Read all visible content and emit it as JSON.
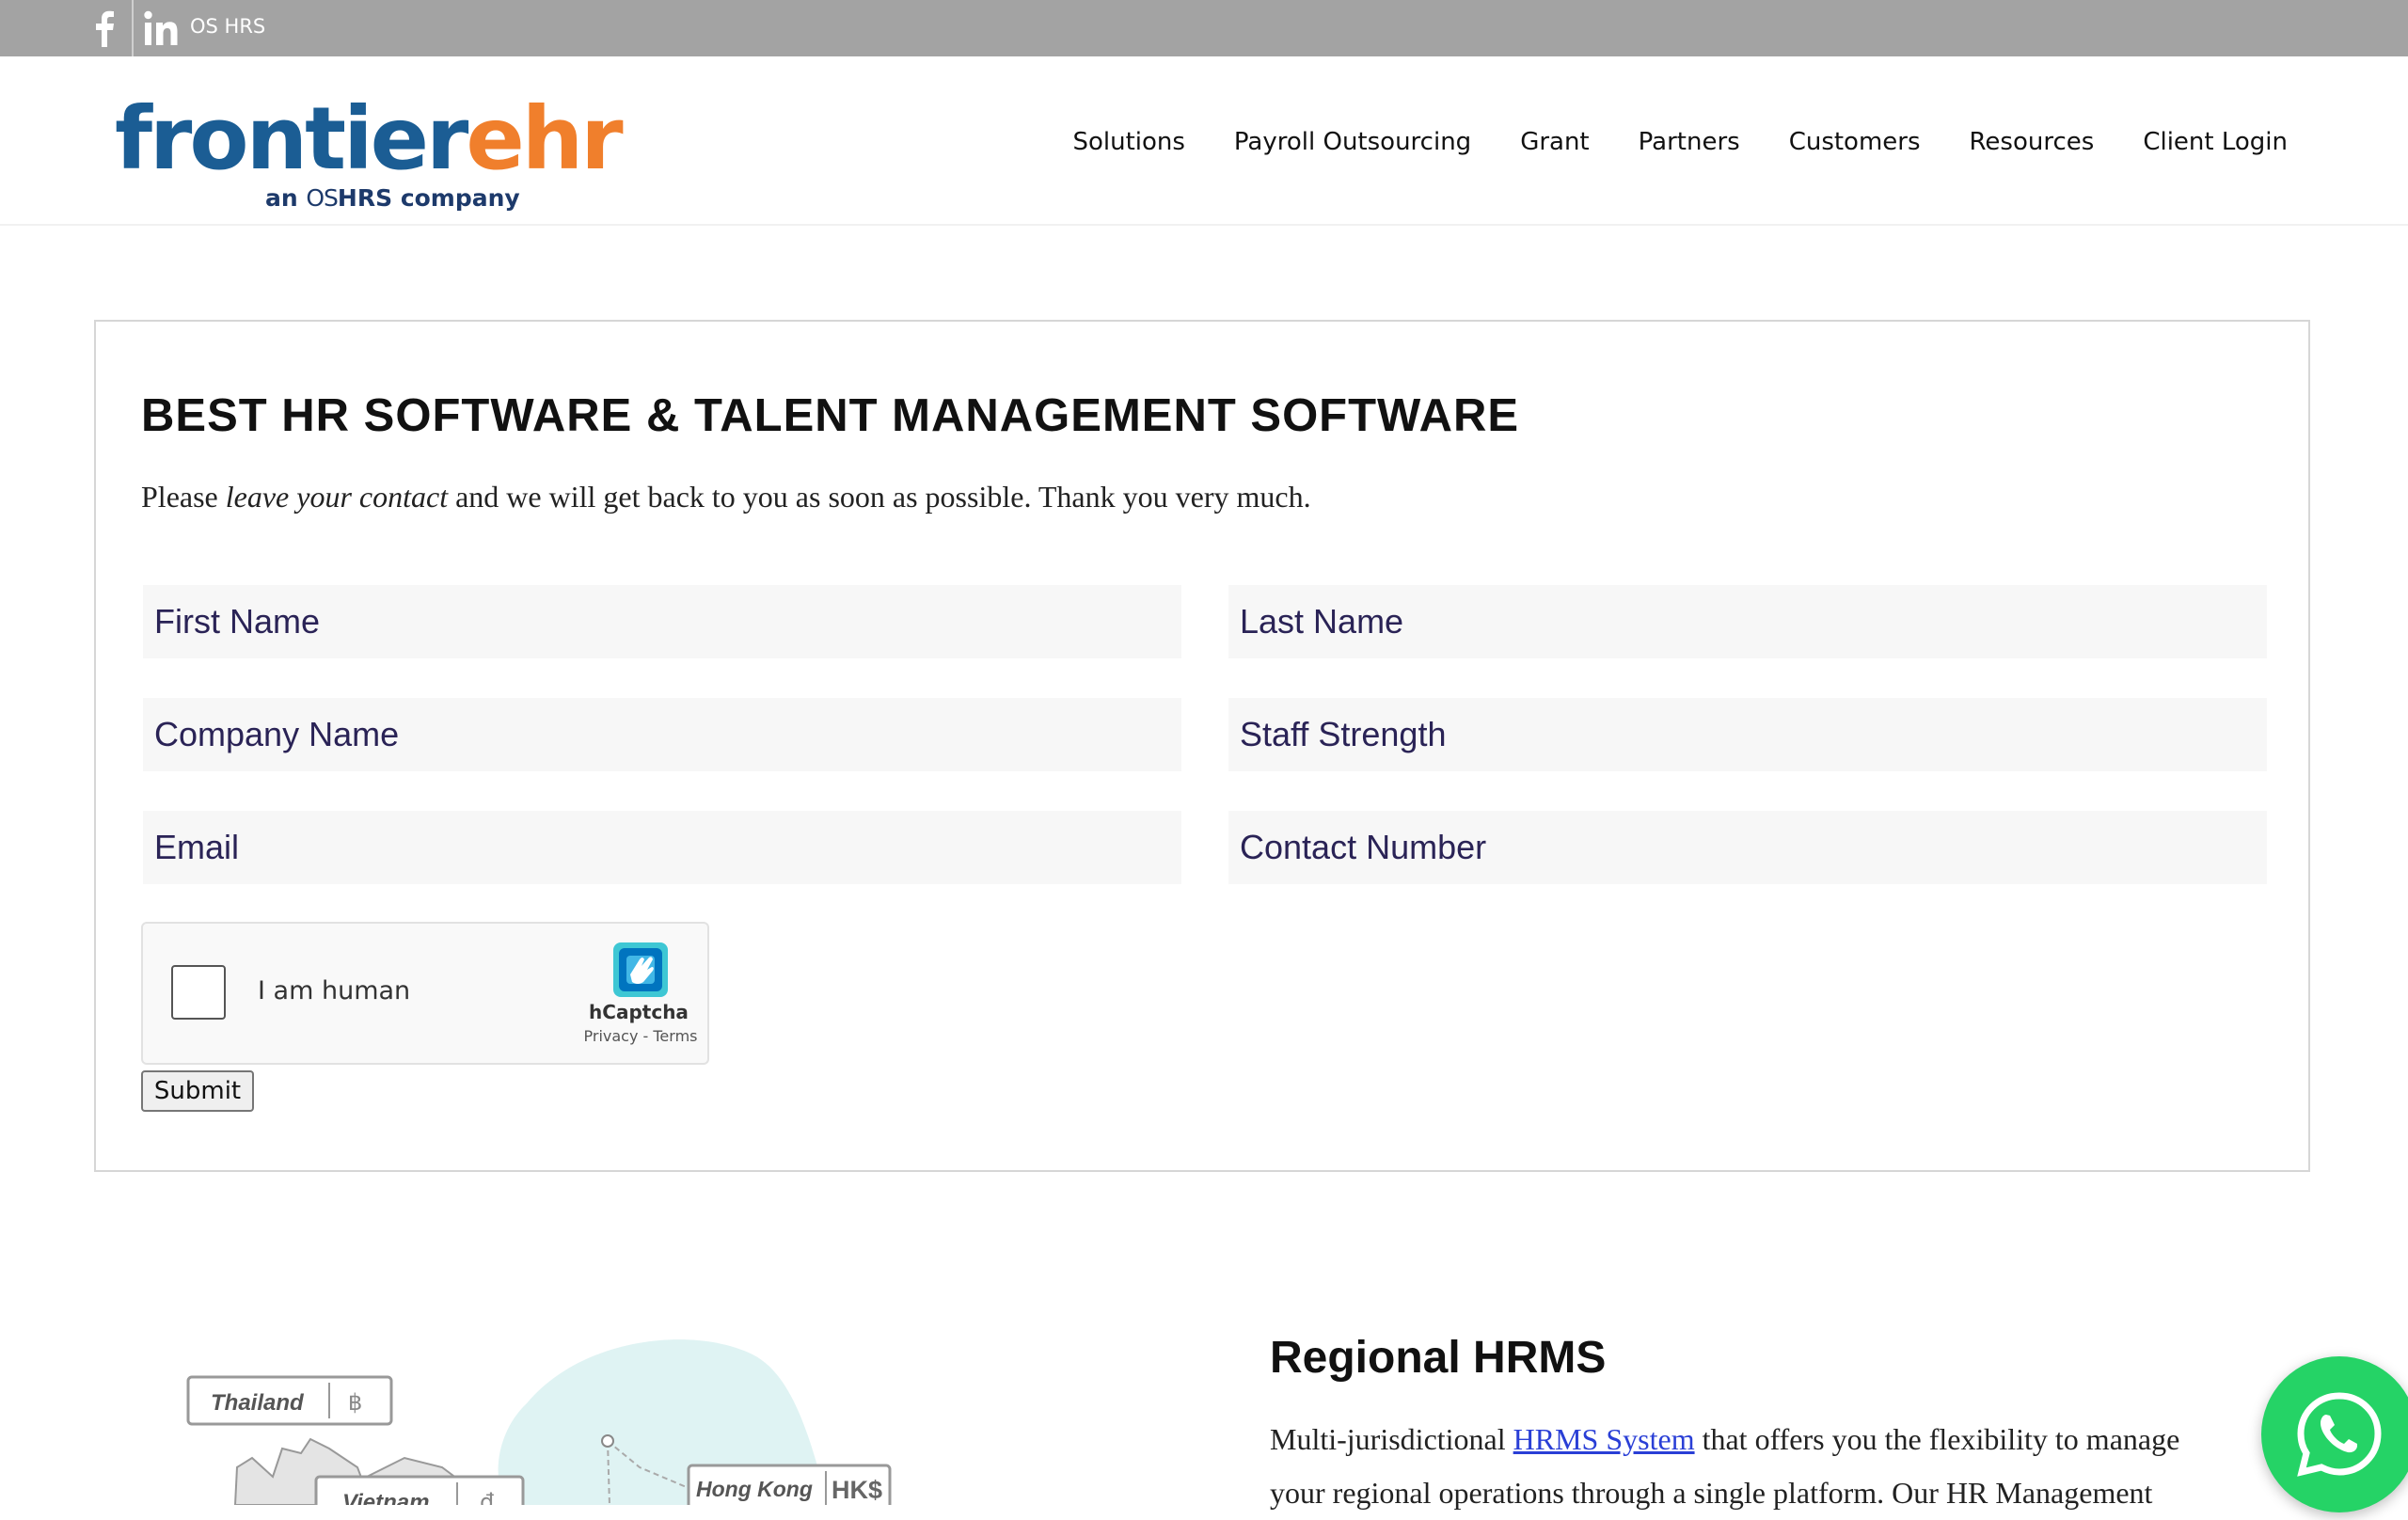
{
  "topbar": {
    "brand": "OS HRS",
    "icons": [
      "facebook-icon",
      "linkedin-icon"
    ],
    "background": "#a3a3a3"
  },
  "logo": {
    "word_part1": "frontier",
    "word_part2": "ehr",
    "sub_prefix": "an ",
    "sub_os": "OS",
    "sub_hrs": "HRS",
    "sub_suffix": " company",
    "colors": {
      "primary": "#1b5d94",
      "accent": "#f07f2c"
    }
  },
  "nav": {
    "items": [
      "Solutions",
      "Payroll Outsourcing",
      "Grant",
      "Partners",
      "Customers",
      "Resources",
      "Client Login"
    ]
  },
  "form": {
    "title": "BEST HR SOFTWARE & TALENT MANAGEMENT SOFTWARE",
    "subtitle_before": "Please ",
    "subtitle_em": "leave your contact",
    "subtitle_after": " and we will get back to you as soon as possible. Thank you very much.",
    "fields": {
      "first_name": "First Name",
      "last_name": "Last Name",
      "company_name": "Company Name",
      "staff_strength": "Staff Strength",
      "email": "Email",
      "contact_number": "Contact Number"
    },
    "captcha": {
      "label": "I am human",
      "provider": "hCaptcha",
      "links": "Privacy - Terms"
    },
    "submit_label": "Submit"
  },
  "regional": {
    "title": "Regional HRMS",
    "text_before": "Multi-jurisdictional ",
    "link_text": "HRMS System",
    "text_after": " that offers you the flexibility to manage",
    "line2": "your regional operations through a single platform. Our HR Management",
    "map_labels": [
      {
        "country": "Thailand",
        "currency": "฿"
      },
      {
        "country": "Vietnam",
        "currency": "₫"
      },
      {
        "country": "Hong Kong",
        "currency": "HK$"
      }
    ]
  },
  "whatsapp": {
    "icon": "whatsapp-icon",
    "color": "#25d366"
  }
}
